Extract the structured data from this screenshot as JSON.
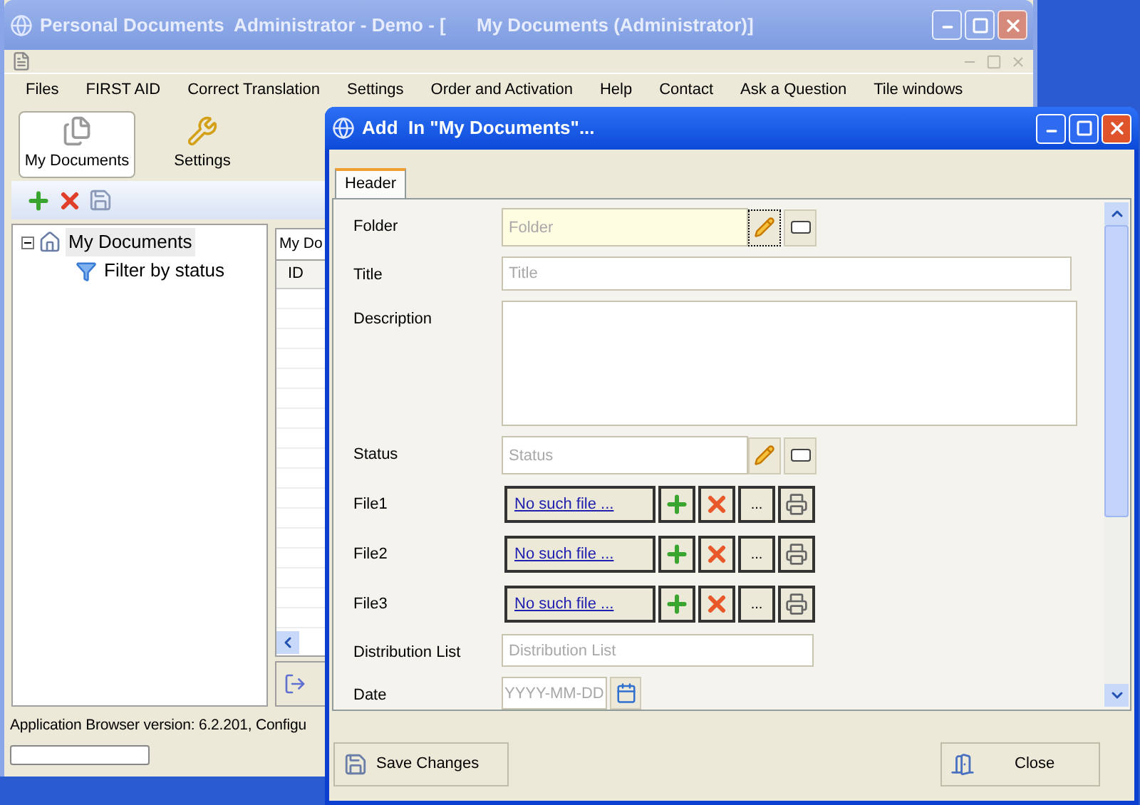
{
  "main_window": {
    "title": "Personal Documents  Administrator - Demo - [      My Documents (Administrator)]",
    "menu": [
      "Files",
      "FIRST AID",
      "Correct Translation",
      "Settings",
      "Order and Activation",
      "Help",
      "Contact",
      "Ask a Question",
      "Tile windows"
    ],
    "toolbar": [
      {
        "kind": "documents",
        "label": "My Documents",
        "selected": true
      },
      {
        "kind": "settings",
        "label": "Settings",
        "selected": false
      }
    ],
    "tree": [
      {
        "label": "My Documents",
        "selected": true,
        "expanded": true,
        "children": [
          {
            "label": "Filter by status",
            "selected": false
          }
        ]
      }
    ],
    "grid": {
      "tab": "My Do",
      "columns": [
        "ID"
      ]
    },
    "status_bar": "Application Browser version: 6.2.201, Configu",
    "progress": {
      "level": 0
    }
  },
  "dialog": {
    "title": "Add  In \"My Documents\"...",
    "tabs": [
      {
        "label": "Header",
        "selected": true
      }
    ],
    "fields": [
      {
        "kind": "lookup",
        "label": "Folder",
        "placeholder": "Folder",
        "focused": true
      },
      {
        "kind": "text",
        "label": "Title",
        "placeholder": "Title"
      },
      {
        "kind": "textarea",
        "label": "Description"
      },
      {
        "kind": "lookup",
        "label": "Status",
        "placeholder": "Status",
        "focused": false
      },
      {
        "kind": "file",
        "label": "File1",
        "link": "No such file ...",
        "browse": "..."
      },
      {
        "kind": "file",
        "label": "File2",
        "link": "No such file ...",
        "browse": "..."
      },
      {
        "kind": "file",
        "label": "File3",
        "link": "No such file ...",
        "browse": "..."
      },
      {
        "kind": "text_short",
        "label": "Distribution List",
        "placeholder": "Distribution List"
      },
      {
        "kind": "date",
        "label": "Date",
        "placeholder": "YYYY-MM-DD"
      }
    ],
    "buttons": [
      {
        "kind": "save",
        "label": "Save Changes"
      },
      {
        "kind": "close",
        "label": "Close"
      }
    ]
  }
}
